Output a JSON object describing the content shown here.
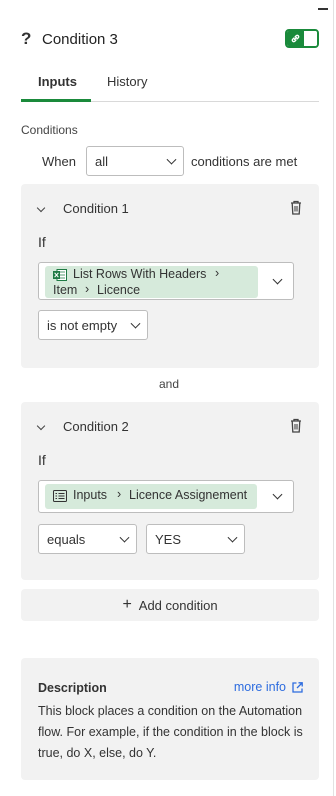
{
  "header": {
    "title": "Condition 3",
    "toggle_state": "on",
    "accent": "#1a8a3b"
  },
  "tabs": [
    {
      "label": "Inputs",
      "active": true
    },
    {
      "label": "History",
      "active": false
    }
  ],
  "conditions": {
    "label": "Conditions",
    "when_prefix": "When",
    "when_value": "all",
    "when_suffix": "conditions are met"
  },
  "condition_blocks": [
    {
      "title": "Condition 1",
      "if_label": "If",
      "chip_icon": "excel-icon",
      "chip_parts": [
        "List Rows With Headers",
        "Item",
        "Licence"
      ],
      "operator": "is not empty"
    },
    {
      "title": "Condition 2",
      "if_label": "If",
      "chip_icon": "inputs-list-icon",
      "chip_parts": [
        "Inputs",
        "Licence Assignement"
      ],
      "operator": "equals",
      "value": "YES"
    }
  ],
  "and_label": "and",
  "add_condition": {
    "label": "Add condition"
  },
  "description": {
    "title": "Description",
    "more_info": "more info",
    "text": "This block places a condition on the Automation flow. For example, if the condition in the block is true, do X, else, do Y."
  },
  "colors": {
    "accent": "#1a8a3b",
    "chip_bg": "#d6eadb",
    "card_bg": "#f2f2f2",
    "link": "#2d6cdf"
  }
}
